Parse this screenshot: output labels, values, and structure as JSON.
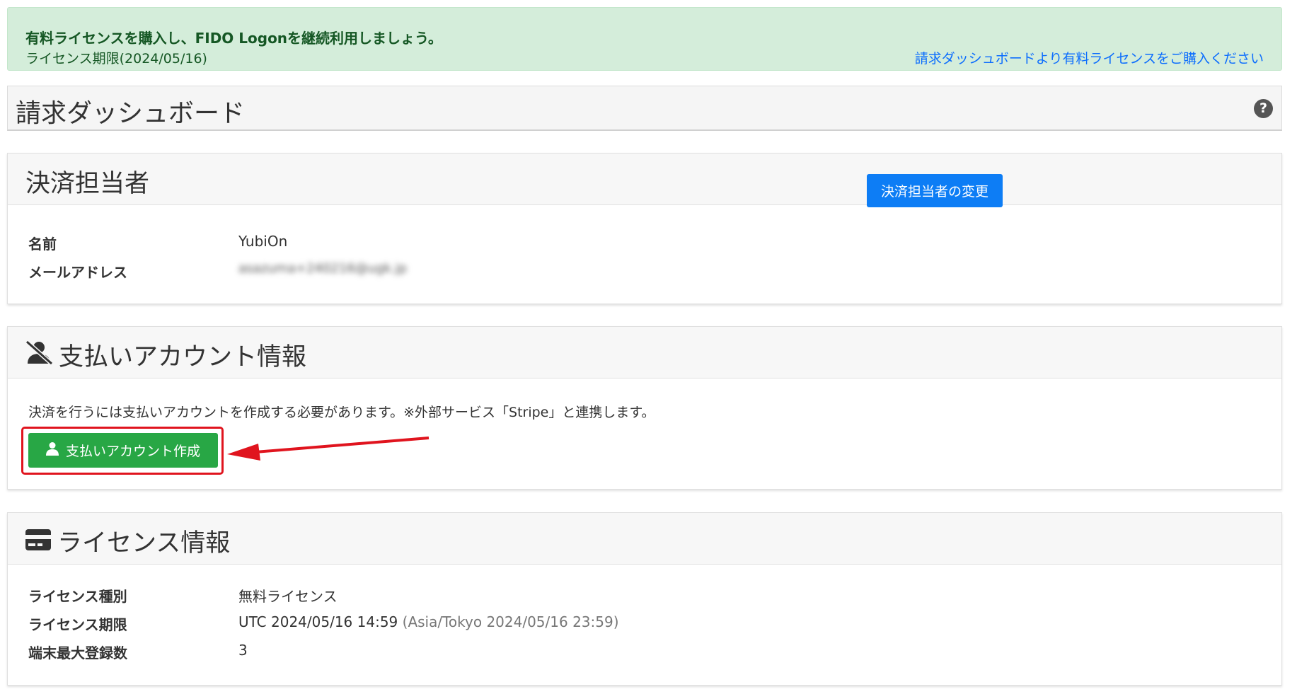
{
  "alert": {
    "title": "有料ライセンスを購入し、FIDO Logonを継続利用しましょう。",
    "subtitle": "ライセンス期限(2024/05/16)",
    "link": "請求ダッシュボードより有料ライセンスをご購入ください"
  },
  "header": {
    "title": "請求ダッシュボード",
    "help_icon": "?"
  },
  "payer": {
    "title": "決済担当者",
    "name_label": "名前",
    "name_value": "YubiOn",
    "email_label": "メールアドレス",
    "email_value": "asazuma+240216@ugk.jp",
    "change_button": "決済担当者の変更"
  },
  "payment_account": {
    "title": "支払いアカウント情報",
    "icon": "user-slash-icon",
    "description": "決済を行うには支払いアカウントを作成する必要があります。※外部サービス「Stripe」と連携します。",
    "create_button": "支払いアカウント作成",
    "button_icon": "user-icon"
  },
  "license": {
    "title": "ライセンス情報",
    "icon": "credit-card-icon",
    "type_label": "ライセンス種別",
    "type_value": "無料ライセンス",
    "expiry_label": "ライセンス期限",
    "expiry_utc": "UTC 2024/05/16 14:59",
    "expiry_local": " (Asia/Tokyo 2024/05/16 23:59)",
    "max_devices_label": "端末最大登録数",
    "max_devices_value": "3"
  },
  "colors": {
    "alert_bg": "#d4edda",
    "link": "#0d6efd",
    "primary_button": "#0d7df5",
    "success_button": "#28a745",
    "highlight": "#e0141e"
  }
}
